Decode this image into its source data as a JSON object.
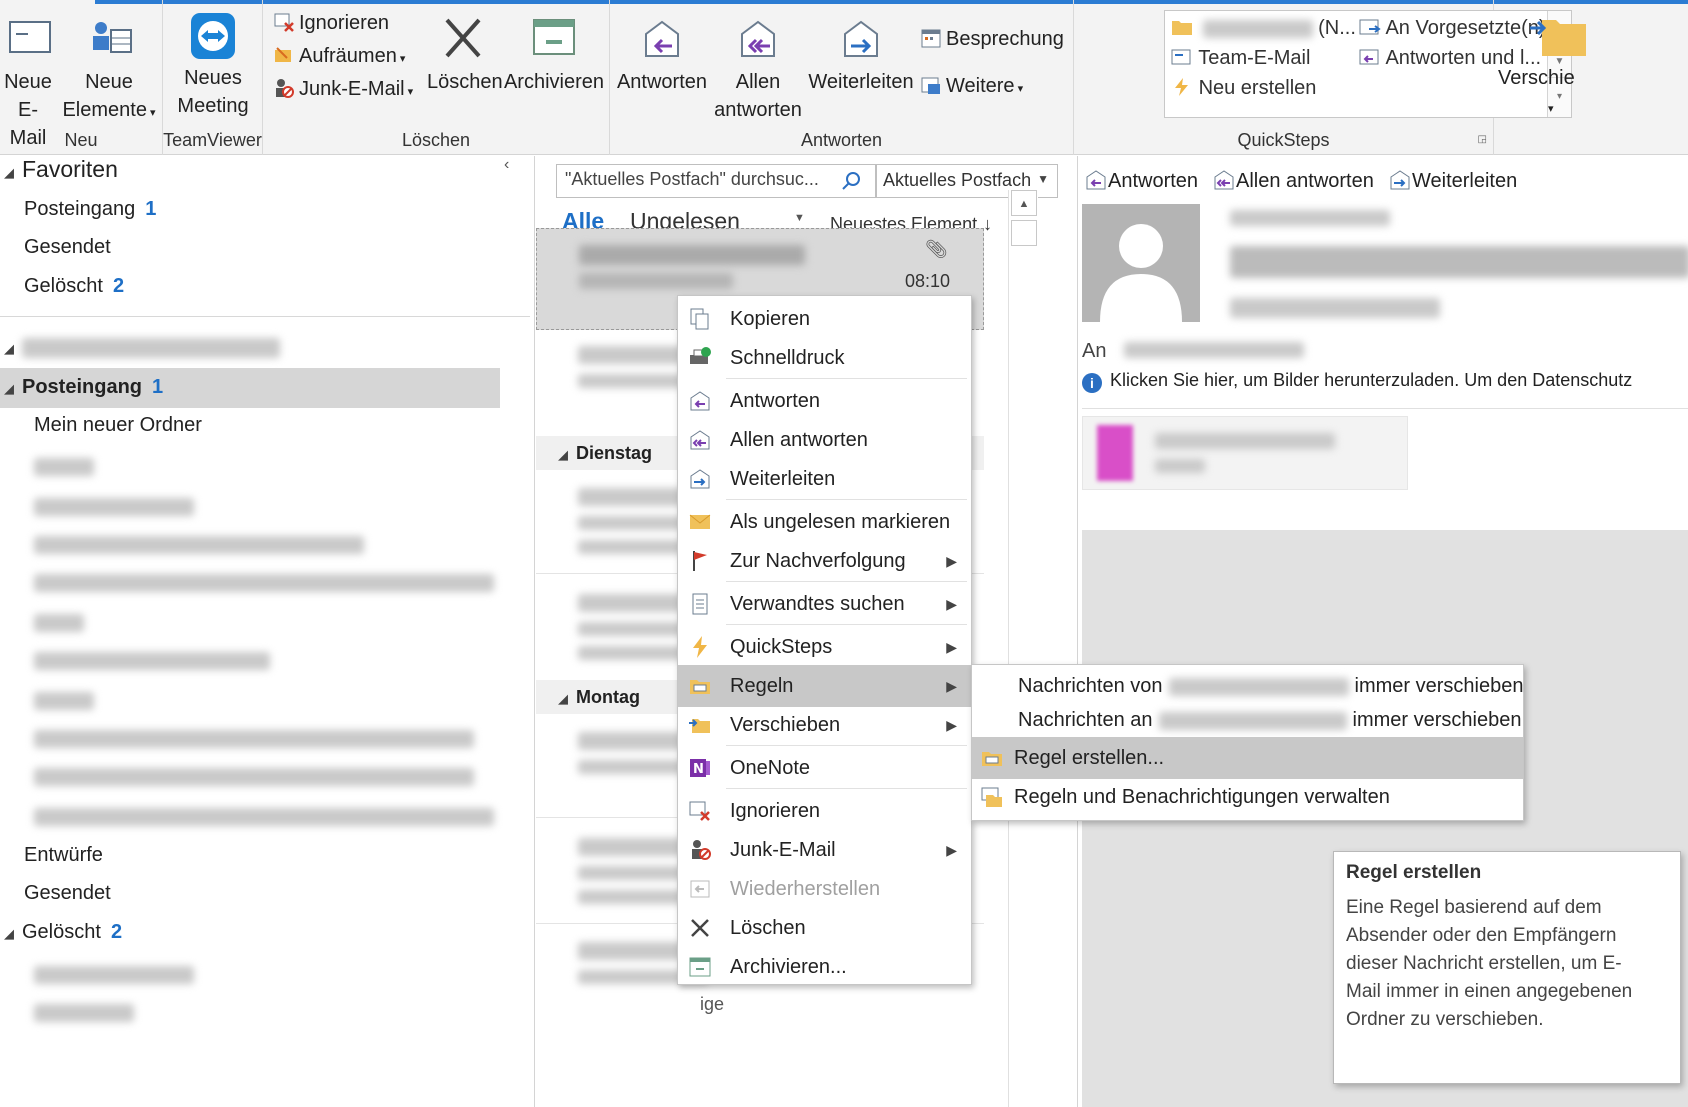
{
  "ribbon": {
    "groups": {
      "neu": "Neu",
      "teamviewer": "TeamViewer",
      "loeschen": "Löschen",
      "antworten": "Antworten",
      "quicksteps": "QuickSteps"
    },
    "buttons": {
      "new_email_1": "Neue",
      "new_email_2": "E-Mail",
      "new_items_1": "Neue",
      "new_items_2": "Elemente",
      "new_meeting_1": "Neues",
      "new_meeting_2": "Meeting",
      "ignore": "Ignorieren",
      "cleanup": "Aufräumen",
      "junk": "Junk-E-Mail",
      "delete": "Löschen",
      "archive": "Archivieren",
      "reply": "Antworten",
      "reply_all_1": "Allen",
      "reply_all_2": "antworten",
      "forward": "Weiterleiten",
      "meeting": "Besprechung",
      "more": "Weitere",
      "move": "Verschie"
    },
    "quicksteps": {
      "item1_suffix": "(N...",
      "item2": "An Vorgesetzte(n)",
      "item3": "Team-E-Mail",
      "item4": "Antworten und l...",
      "item5": "Neu erstellen"
    }
  },
  "nav": {
    "favorites": "Favoriten",
    "fav_items": [
      {
        "label": "Posteingang",
        "count": "1"
      },
      {
        "label": "Gesendet",
        "count": ""
      },
      {
        "label": "Gelöscht",
        "count": "2"
      }
    ],
    "inbox": "Posteingang",
    "inbox_count": "1",
    "subfolder": "Mein neuer Ordner",
    "drafts": "Entwürfe",
    "sent": "Gesendet",
    "deleted": "Gelöscht",
    "deleted_count": "2"
  },
  "list": {
    "search_placeholder": "\"Aktuelles Postfach\" durchsuc...",
    "scope": "Aktuelles Postfach",
    "tab_all": "Alle",
    "tab_unread": "Ungelesen",
    "sort": "Neuestes Element",
    "first_time": "08:10",
    "group_tuesday": "Dienstag",
    "group_monday": "Montag",
    "footer_text": "ige"
  },
  "reading": {
    "reply": "Antworten",
    "reply_all": "Allen antworten",
    "forward": "Weiterleiten",
    "to_label": "An",
    "info": "Klicken Sie hier, um Bilder herunterzuladen. Um den Datenschutz"
  },
  "context_menu": {
    "copy": "Kopieren",
    "quickprint": "Schnelldruck",
    "reply": "Antworten",
    "reply_all": "Allen antworten",
    "forward": "Weiterleiten",
    "mark_unread": "Als ungelesen markieren",
    "followup": "Zur Nachverfolgung",
    "related": "Verwandtes suchen",
    "quicksteps": "QuickSteps",
    "rules": "Regeln",
    "move": "Verschieben",
    "onenote": "OneNote",
    "ignore": "Ignorieren",
    "junk": "Junk-E-Mail",
    "restore": "Wiederherstellen",
    "delete": "Löschen",
    "archive": "Archivieren..."
  },
  "submenu": {
    "always_from_1": "Nachrichten von",
    "always_from_2": "immer verschieben",
    "always_to_1": "Nachrichten an",
    "always_to_2": "immer verschieben",
    "create_rule": "Regel erstellen...",
    "manage_rules": "Regeln und Benachrichtigungen verwalten"
  },
  "tooltip": {
    "title": "Regel erstellen",
    "body": "Eine Regel basierend auf dem Absender oder den Empfängern dieser Nachricht erstellen, um E-Mail immer in einen angegebenen Ordner zu verschieben."
  },
  "colors": {
    "accent": "#2b7cd3",
    "count": "#1e6fc6",
    "highlight": "#c8c8c8"
  }
}
